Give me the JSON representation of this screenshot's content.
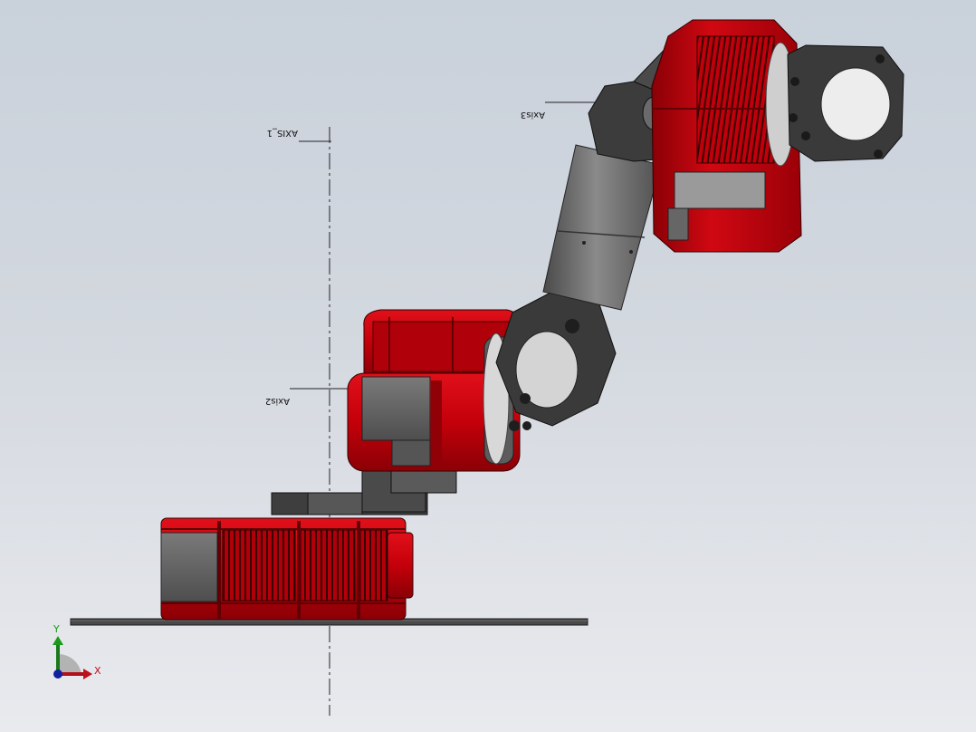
{
  "model_view": {
    "axis_labels": {
      "axis1": "AXIS_1",
      "axis2": "Axis2",
      "axis3": "Axis3"
    },
    "triad": {
      "x_label": "X",
      "y_label": "Y"
    },
    "colors": {
      "red": "#c4000a",
      "dark_red": "#7a0006",
      "gray": "#6e6e6e",
      "dark_gray": "#3c3c3c"
    }
  }
}
